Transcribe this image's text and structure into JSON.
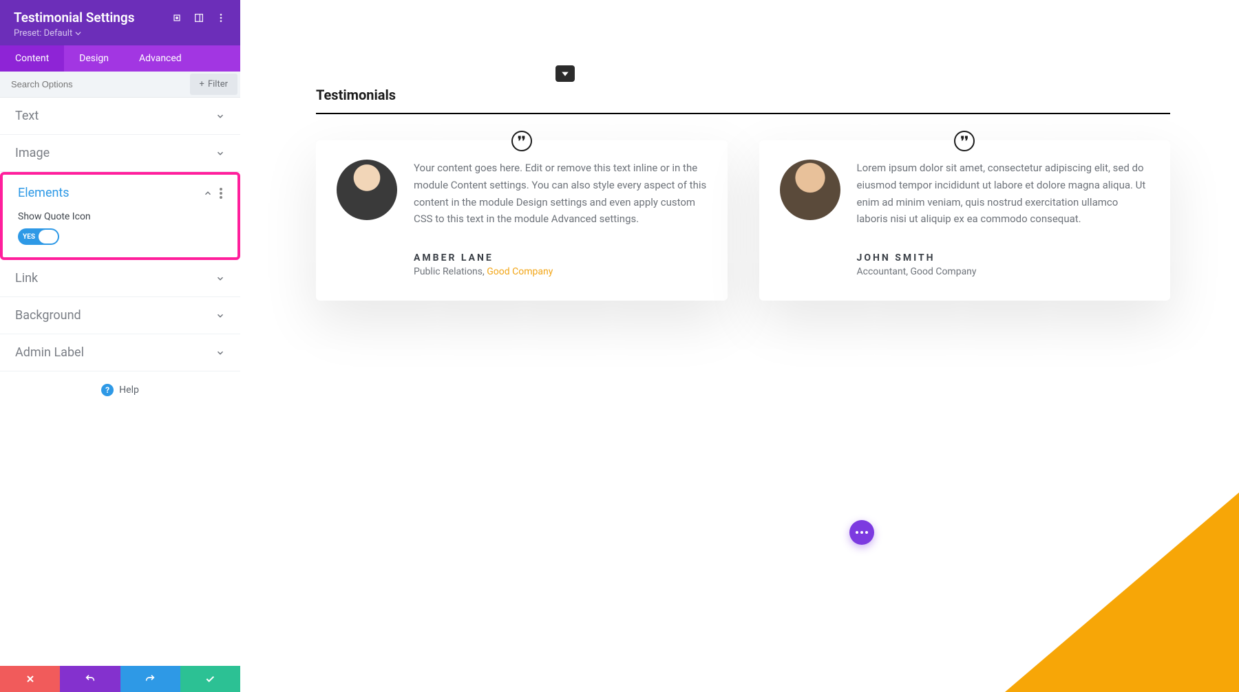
{
  "header": {
    "title": "Testimonial Settings",
    "preset_label": "Preset: Default"
  },
  "tabs": {
    "content": "Content",
    "design": "Design",
    "advanced": "Advanced"
  },
  "search": {
    "placeholder": "Search Options",
    "filter_label": "Filter"
  },
  "sections": {
    "text": "Text",
    "image": "Image",
    "elements": "Elements",
    "link": "Link",
    "background": "Background",
    "admin_label": "Admin Label"
  },
  "elements": {
    "show_quote_label": "Show Quote Icon",
    "toggle_yes": "YES"
  },
  "help": "Help",
  "preview": {
    "section_title": "Testimonials",
    "cards": [
      {
        "content": "Your content goes here. Edit or remove this text inline or in the module Content settings. You can also style every aspect of this content in the module Design settings and even apply custom CSS to this text in the module Advanced settings.",
        "name": "AMBER LANE",
        "role_prefix": "Public Relations, ",
        "company": "Good Company"
      },
      {
        "content": "Lorem ipsum dolor sit amet, consectetur adipiscing elit, sed do eiusmod tempor incididunt ut labore et dolore magna aliqua. Ut enim ad minim veniam, quis nostrud exercitation ullamco laboris nisi ut aliquip ex ea commodo consequat.",
        "name": "JOHN SMITH",
        "role_full": "Accountant, Good Company"
      }
    ]
  }
}
